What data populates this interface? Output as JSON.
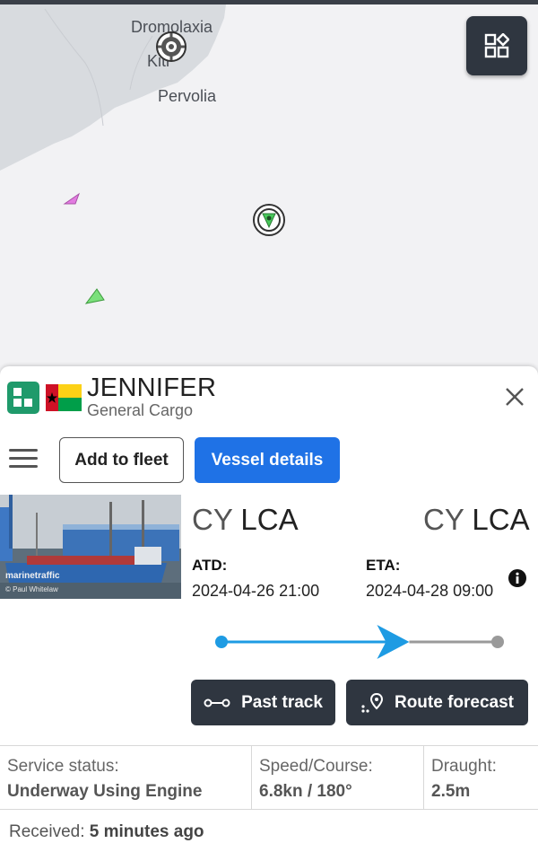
{
  "map": {
    "places": {
      "dromolaxia": "Dromolaxia",
      "kiti": "Kiti",
      "pervolia": "Pervolia"
    },
    "layers_button_icon": "layers-grid-icon",
    "port_marker_icon": "port-gear-icon",
    "vessel_marker_icon": "vessel-selected-icon"
  },
  "vessel": {
    "name": "JENNIFER",
    "type": "General Cargo",
    "flag": "Guinea-Bissau",
    "logo_icon": "app-logo-icon",
    "close_icon": "close-icon"
  },
  "actions": {
    "menu_icon": "hamburger-menu-icon",
    "add_to_fleet": "Add to fleet",
    "vessel_details": "Vessel details"
  },
  "photo": {
    "watermark": "marinetraffic",
    "credit": "© Paul Whitelaw"
  },
  "voyage": {
    "from_country": "CY",
    "from_port": "LCA",
    "to_country": "CY",
    "to_port": "LCA",
    "atd_label": "ATD:",
    "atd_value": "2024-04-26 21:00",
    "eta_label": "ETA:",
    "eta_value": "2024-04-28 09:00",
    "info_icon": "info-icon",
    "progress": 0.68
  },
  "buttons": {
    "past_track": "Past track",
    "route_forecast": "Route forecast"
  },
  "stats": {
    "service_status_label": "Service status:",
    "service_status_value": "Underway Using Engine",
    "speed_course_label": "Speed/Course:",
    "speed_course_value": "6.8kn / 180°",
    "draught_label": "Draught:",
    "draught_value": "2.5m"
  },
  "received": {
    "label": "Received:",
    "value": "5 minutes ago"
  },
  "colors": {
    "primary_blue": "#1f72e6",
    "dark_button": "#2f3640",
    "logo_green": "#1f9a6b",
    "progress_blue": "#1e9be3",
    "progress_grey": "#9a9a9a"
  }
}
